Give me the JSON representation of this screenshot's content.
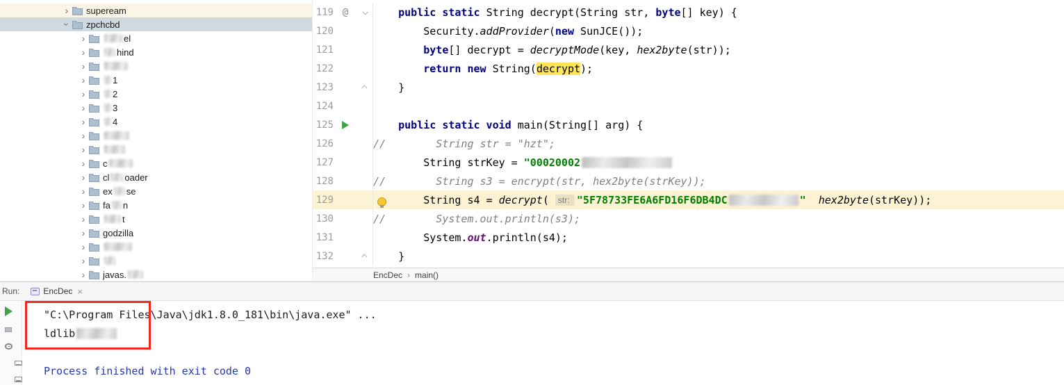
{
  "tree": {
    "items": [
      {
        "level": 1,
        "expanded": false,
        "warm": true,
        "parts": [
          {
            "t": "supeream"
          }
        ]
      },
      {
        "level": 1,
        "expanded": true,
        "selected": true,
        "parts": [
          {
            "t": "zpchcbd"
          }
        ]
      },
      {
        "level": 2,
        "expanded": false,
        "parts": [
          {
            "b": 26
          },
          {
            "t": "el"
          }
        ]
      },
      {
        "level": 2,
        "expanded": false,
        "parts": [
          {
            "b": 16
          },
          {
            "t": "hind"
          }
        ]
      },
      {
        "level": 2,
        "expanded": false,
        "parts": [
          {
            "b": 34
          }
        ]
      },
      {
        "level": 2,
        "expanded": false,
        "parts": [
          {
            "b": 10
          },
          {
            "t": "1"
          }
        ]
      },
      {
        "level": 2,
        "expanded": false,
        "parts": [
          {
            "b": 10
          },
          {
            "t": "2"
          }
        ]
      },
      {
        "level": 2,
        "expanded": false,
        "parts": [
          {
            "b": 10
          },
          {
            "t": "3"
          }
        ]
      },
      {
        "level": 2,
        "expanded": false,
        "parts": [
          {
            "b": 10
          },
          {
            "t": "4"
          }
        ]
      },
      {
        "level": 2,
        "expanded": false,
        "parts": [
          {
            "b": 36
          }
        ]
      },
      {
        "level": 2,
        "expanded": false,
        "parts": [
          {
            "b": 30
          }
        ]
      },
      {
        "level": 2,
        "expanded": false,
        "parts": [
          {
            "t": "c"
          },
          {
            "b": 34
          }
        ]
      },
      {
        "level": 2,
        "expanded": false,
        "parts": [
          {
            "t": "cl"
          },
          {
            "b": 18
          },
          {
            "t": "oader"
          }
        ]
      },
      {
        "level": 2,
        "expanded": false,
        "parts": [
          {
            "t": "ex"
          },
          {
            "b": 16
          },
          {
            "t": "se"
          }
        ]
      },
      {
        "level": 2,
        "expanded": false,
        "parts": [
          {
            "t": "fa"
          },
          {
            "b": 14
          },
          {
            "t": "n"
          }
        ]
      },
      {
        "level": 2,
        "expanded": false,
        "parts": [
          {
            "b": 24
          },
          {
            "t": "t"
          }
        ]
      },
      {
        "level": 2,
        "expanded": false,
        "parts": [
          {
            "t": "godzilla"
          }
        ]
      },
      {
        "level": 2,
        "expanded": false,
        "parts": [
          {
            "b": 40
          }
        ]
      },
      {
        "level": 2,
        "expanded": false,
        "parts": [
          {
            "b": 16
          }
        ]
      },
      {
        "level": 2,
        "expanded": false,
        "parts": [
          {
            "t": "javas."
          },
          {
            "b": 22
          }
        ]
      }
    ]
  },
  "editor": {
    "lines": [
      {
        "n": "119",
        "icon": "annotation",
        "fold": "down",
        "segs": [
          {
            "t": "    ",
            "c": "p"
          },
          {
            "t": "public static ",
            "c": "k"
          },
          {
            "t": "String decrypt(String str, ",
            "c": "p"
          },
          {
            "t": "byte",
            "c": "k"
          },
          {
            "t": "[] key) {",
            "c": "p"
          }
        ]
      },
      {
        "n": "120",
        "segs": [
          {
            "t": "        Security.",
            "c": "p"
          },
          {
            "t": "addProvider",
            "c": "it"
          },
          {
            "t": "(",
            "c": "p"
          },
          {
            "t": "new ",
            "c": "k"
          },
          {
            "t": "SunJCE());",
            "c": "p"
          }
        ]
      },
      {
        "n": "121",
        "segs": [
          {
            "t": "        ",
            "c": "p"
          },
          {
            "t": "byte",
            "c": "k"
          },
          {
            "t": "[] decrypt = ",
            "c": "p"
          },
          {
            "t": "decryptMode",
            "c": "it"
          },
          {
            "t": "(key, ",
            "c": "p"
          },
          {
            "t": "hex2byte",
            "c": "it"
          },
          {
            "t": "(str));",
            "c": "p"
          }
        ]
      },
      {
        "n": "122",
        "segs": [
          {
            "t": "        ",
            "c": "p"
          },
          {
            "t": "return new ",
            "c": "k"
          },
          {
            "t": "String(",
            "c": "p"
          },
          {
            "t": "decrypt",
            "c": "p hlw"
          },
          {
            "t": ");",
            "c": "p"
          }
        ]
      },
      {
        "n": "123",
        "fold": "up",
        "segs": [
          {
            "t": "    }",
            "c": "p"
          }
        ]
      },
      {
        "n": "124",
        "segs": []
      },
      {
        "n": "125",
        "icon": "run",
        "segs": [
          {
            "t": "    ",
            "c": "p"
          },
          {
            "t": "public static void ",
            "c": "k"
          },
          {
            "t": "main(String[] arg) {",
            "c": "p"
          }
        ]
      },
      {
        "n": "126",
        "segs": [
          {
            "t": "//        String str = \"hzt\";",
            "c": "cm"
          }
        ]
      },
      {
        "n": "127",
        "segs": [
          {
            "t": "        String strKey = ",
            "c": "p"
          },
          {
            "t": "\"00020002",
            "c": "s"
          },
          {
            "b": 130
          }
        ]
      },
      {
        "n": "128",
        "segs": [
          {
            "t": "//        String s3 = encrypt(str, hex2byte(strKey));",
            "c": "cm"
          }
        ]
      },
      {
        "n": "129",
        "icon": "bulb",
        "highlight": true,
        "segs": [
          {
            "t": "        String s4 = ",
            "c": "p"
          },
          {
            "t": "decrypt",
            "c": "it"
          },
          {
            "t": "( ",
            "c": "p"
          },
          {
            "hint": "str: "
          },
          {
            "t": "\"5F78733FE6A6FD16F6DB4DC",
            "c": "s"
          },
          {
            "b": 100
          },
          {
            "t": "\"",
            "c": "s"
          },
          {
            "t": "  ",
            "c": "p"
          },
          {
            "t": "hex2byte",
            "c": "it"
          },
          {
            "t": "(strKey));",
            "c": "p"
          }
        ]
      },
      {
        "n": "130",
        "segs": [
          {
            "t": "//        System.out.println(s3);",
            "c": "cm"
          }
        ]
      },
      {
        "n": "131",
        "segs": [
          {
            "t": "        System.",
            "c": "p"
          },
          {
            "t": "out",
            "c": "fld"
          },
          {
            "t": ".println(s4);",
            "c": "p"
          }
        ]
      },
      {
        "n": "132",
        "fold": "up",
        "segs": [
          {
            "t": "    }",
            "c": "p"
          }
        ]
      }
    ],
    "breadcrumbs": {
      "file": "EncDec",
      "sep": "›",
      "member": "main()"
    }
  },
  "run": {
    "label": "Run:",
    "tab": {
      "title": "EncDec",
      "close": "×"
    },
    "toolbar": [
      {
        "name": "rerun"
      },
      {
        "name": "stop"
      },
      {
        "name": "settings"
      },
      {
        "name": "scroll-end"
      },
      {
        "name": "soft-wrap"
      }
    ],
    "console": [
      {
        "segs": [
          {
            "t": "\"C:\\Program Files\\Java\\jdk1.8.0_181\\bin\\java.exe\" ...",
            "c": "out"
          }
        ]
      },
      {
        "segs": [
          {
            "t": "ldlib",
            "c": "out"
          },
          {
            "b": 58
          }
        ]
      },
      {
        "segs": []
      },
      {
        "segs": [
          {
            "t": "Process finished with exit code 0",
            "c": "sys"
          }
        ]
      }
    ]
  },
  "colors": {
    "keyword": "#000080",
    "string": "#008000",
    "comment": "#808080",
    "static_field": "#660E7A",
    "line_highlight": "#FCF3D4",
    "word_highlight": "#FFE45C",
    "tree_selection": "#CFD9E0",
    "run_green": "#3EA344",
    "annotation_red": "#EF2B1E",
    "console_system_blue": "#2637B5"
  }
}
